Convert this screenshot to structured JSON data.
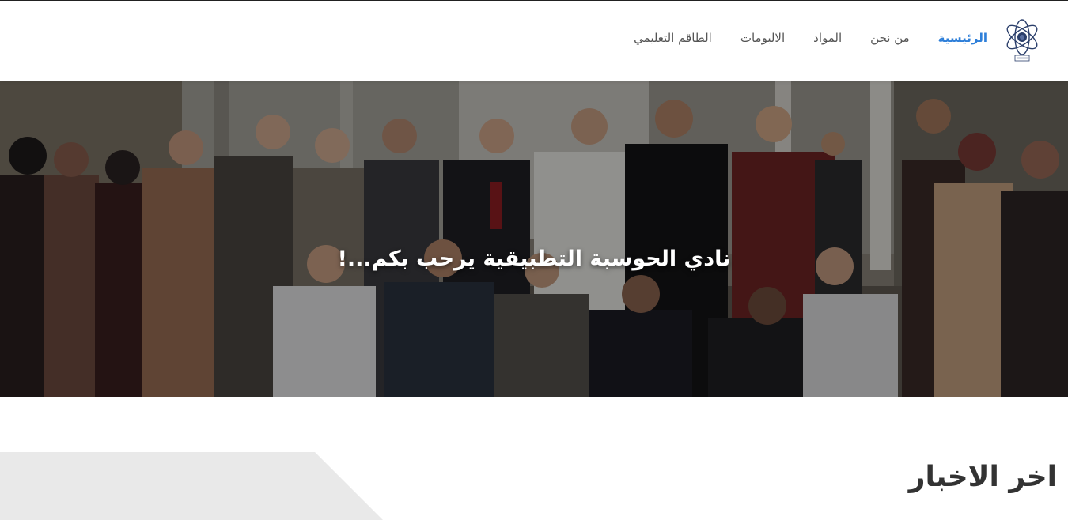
{
  "nav": {
    "logo_name": "club-logo",
    "items": [
      {
        "label": "الرئيسية",
        "active": true
      },
      {
        "label": "من نحن",
        "active": false
      },
      {
        "label": "المواد",
        "active": false
      },
      {
        "label": "الالبومات",
        "active": false
      },
      {
        "label": "الطاقم التعليمي",
        "active": false
      }
    ],
    "active_color": "#2e7fd9"
  },
  "hero": {
    "title": "نادي الحوسبة التطبيقية يرحب بكم...!"
  },
  "news": {
    "heading": "اخر الاخبار"
  }
}
